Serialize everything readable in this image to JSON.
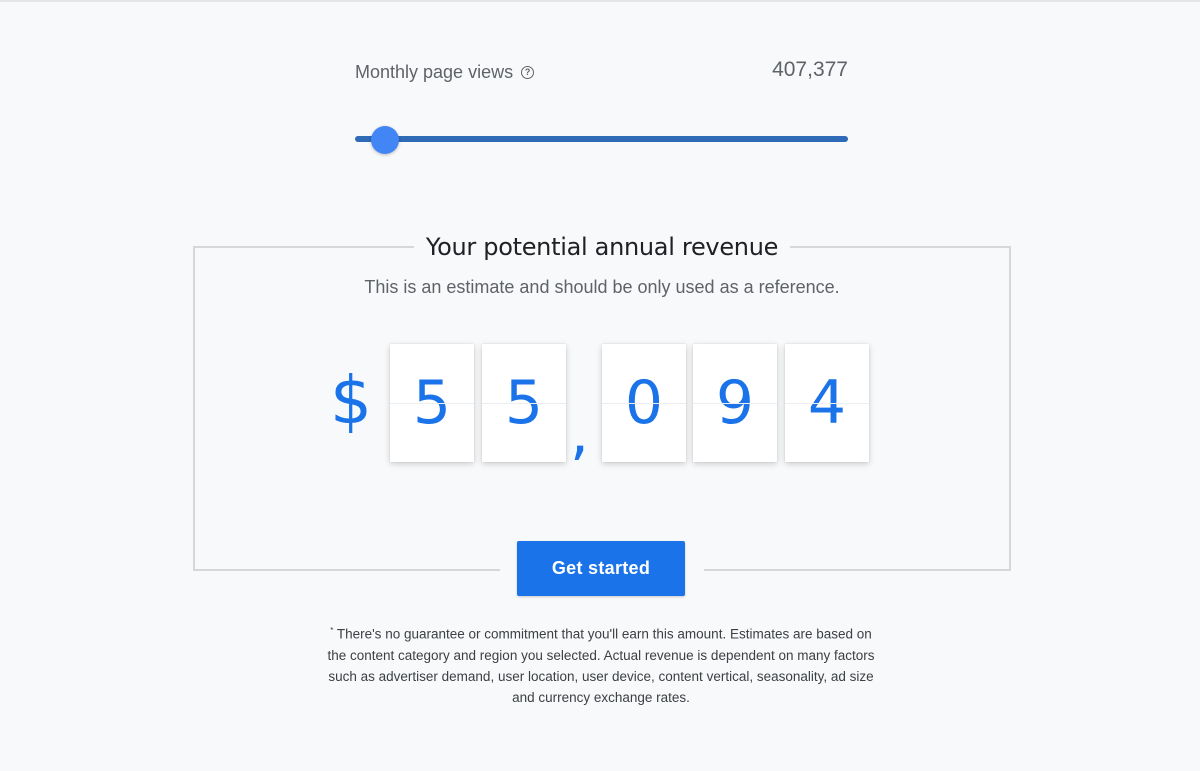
{
  "views": {
    "label": "Monthly page views",
    "help_icon": "question-circle-icon",
    "value": "407,377",
    "slider_fraction": 0.06
  },
  "revenue": {
    "title": "Your potential annual revenue",
    "subtitle": "This is an estimate and should be only used as a reference.",
    "currency": "$",
    "digits": [
      "5",
      "5",
      "0",
      "9",
      "4"
    ],
    "separator": ","
  },
  "cta": {
    "label": "Get started"
  },
  "disclaimer": {
    "mark": "*",
    "text": "There's no guarantee or commitment that you'll earn this amount. Estimates are based on the content category and region you selected. Actual revenue is dependent on many factors such as advertiser demand, user location, user device, content vertical, seasonality, ad size and currency exchange rates."
  },
  "colors": {
    "accent": "#1a73e8",
    "track": "#2f6bb7",
    "thumb": "#4285f4"
  }
}
